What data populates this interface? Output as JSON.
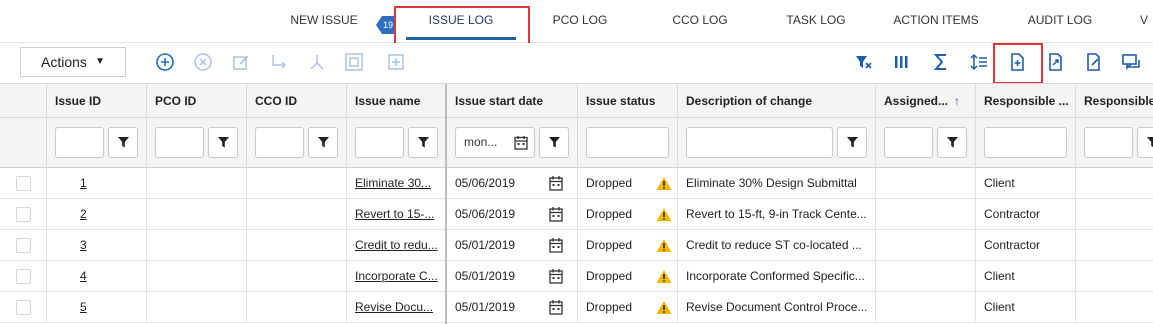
{
  "tabs": [
    {
      "label": "NEW ISSUE"
    },
    {
      "label": "ISSUE LOG"
    },
    {
      "label": "PCO LOG"
    },
    {
      "label": "CCO LOG"
    },
    {
      "label": "TASK LOG"
    },
    {
      "label": "ACTION ITEMS"
    },
    {
      "label": "AUDIT LOG"
    },
    {
      "label": "V"
    }
  ],
  "tab_badge": "19",
  "toolbar": {
    "actions_label": "Actions",
    "left_icons": [
      "add-circle-icon",
      "cancel-circle-icon",
      "edit-icon",
      "redirect-icon",
      "merge-icon",
      "select-all-icon",
      "add-box-icon"
    ],
    "right_icons": [
      "clear-filter-icon",
      "columns-icon",
      "sum-icon",
      "line-spacing-icon",
      "add-document-icon",
      "export-icon",
      "edit-document-icon",
      "comments-icon"
    ]
  },
  "columns": [
    {
      "label": "Issue ID"
    },
    {
      "label": "PCO ID"
    },
    {
      "label": "CCO ID"
    },
    {
      "label": "Issue name"
    },
    {
      "label": "Issue start date"
    },
    {
      "label": "Issue status"
    },
    {
      "label": "Description of change"
    },
    {
      "label": "Assigned..."
    },
    {
      "label": "Responsible ..."
    },
    {
      "label": "Responsible"
    }
  ],
  "filters": {
    "date_value": "mon..."
  },
  "rows": [
    {
      "id": "1",
      "pco": "",
      "cco": "",
      "name": "Eliminate 30...",
      "date": "05/06/2019",
      "status": "Dropped",
      "desc": "Eliminate 30% Design Submittal",
      "assigned": "",
      "responsible": "Client"
    },
    {
      "id": "2",
      "pco": "",
      "cco": "",
      "name": "Revert to 15-...",
      "date": "05/06/2019",
      "status": "Dropped",
      "desc": "Revert to 15-ft, 9-in Track Cente...",
      "assigned": "",
      "responsible": "Contractor"
    },
    {
      "id": "3",
      "pco": "",
      "cco": "",
      "name": "Credit to redu...",
      "date": "05/01/2019",
      "status": "Dropped",
      "desc": "Credit to reduce ST co-located ...",
      "assigned": "",
      "responsible": "Contractor"
    },
    {
      "id": "4",
      "pco": "",
      "cco": "",
      "name": "Incorporate C...",
      "date": "05/01/2019",
      "status": "Dropped",
      "desc": "Incorporate Conformed Specific...",
      "assigned": "",
      "responsible": "Client"
    },
    {
      "id": "5",
      "pco": "",
      "cco": "",
      "name": "Revise Docu...",
      "date": "05/01/2019",
      "status": "Dropped",
      "desc": "Revise Document Control Proce...",
      "assigned": "",
      "responsible": "Client"
    }
  ],
  "colors": {
    "accent": "#1f5fa8",
    "highlight_box": "#e0343a",
    "warning": "#f2b705",
    "icon_blue": "#1f6fbf"
  }
}
